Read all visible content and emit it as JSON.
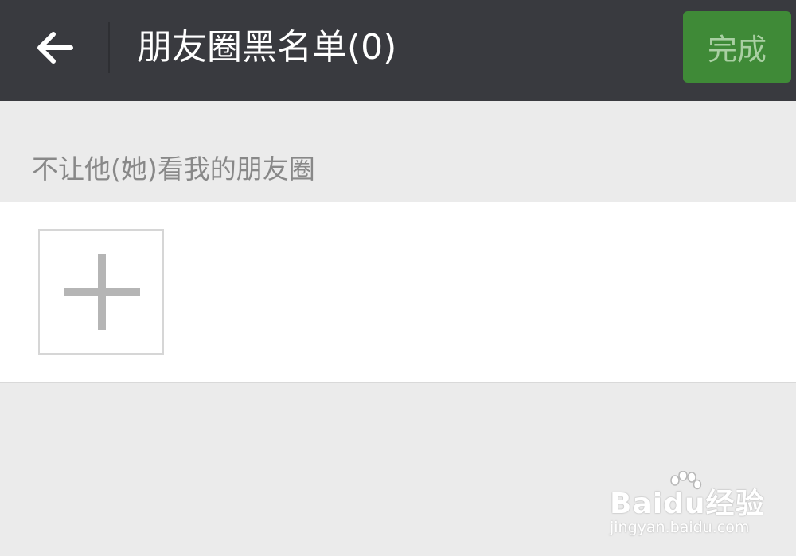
{
  "header": {
    "title": "朋友圈黑名单(0)",
    "done_label": "完成",
    "back_icon": "arrow-left-icon"
  },
  "section": {
    "label": "不让他(她)看我的朋友圈"
  },
  "members": {
    "add_icon": "plus-icon"
  },
  "watermark": {
    "logo_text": "Baidu经验",
    "url": "jingyan.baidu.com"
  },
  "colors": {
    "topbar": "#393a3f",
    "accent": "#3f8a37",
    "background": "#ebebeb"
  }
}
